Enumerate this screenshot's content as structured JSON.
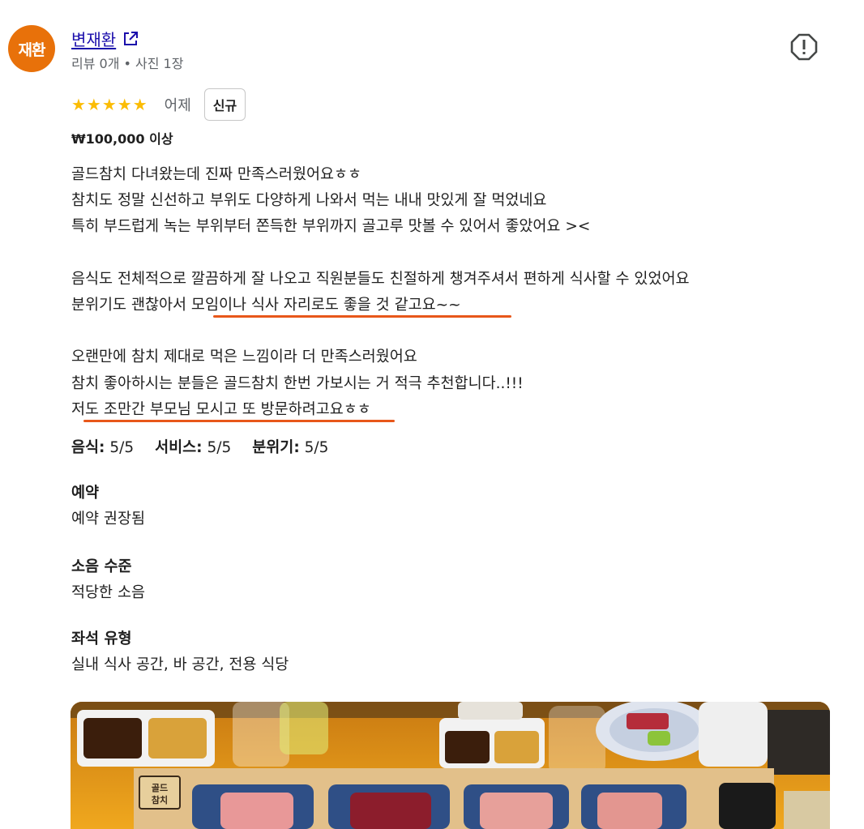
{
  "author": {
    "avatar_text": "재환",
    "name": "변재환",
    "meta": "리뷰 0개 • 사진 1장"
  },
  "rating": {
    "stars": "★★★★★",
    "time": "어제",
    "badge": "신규"
  },
  "price": "₩100,000 이상",
  "review_lines": [
    "골드참치 다녀왔는데 진짜 만족스러웠어요ㅎㅎ",
    "참치도 정말 신선하고 부위도 다양하게 나와서 먹는 내내 맛있게 잘 먹었네요",
    "특히 부드럽게 녹는 부위부터 쫀득한 부위까지 골고루 맛볼 수 있어서 좋았어요 ><",
    "",
    "음식도 전체적으로 깔끔하게 잘 나오고 직원분들도 친절하게 챙겨주셔서 편하게 식사할 수 있었어요",
    "분위기도 괜찮아서 모임이나 식사 자리로도 좋을 것 같고요~~",
    "",
    "오랜만에 참치 제대로 먹은 느낌이라 더 만족스러웠어요",
    "참치 좋아하시는 분들은 골드참치 한번 가보시는 거 적극 추천합니다..!!!",
    "저도 조만간 부모님 모시고 또 방문하려고요ㅎㅎ"
  ],
  "scores": [
    {
      "label": "음식:",
      "value": "5/5"
    },
    {
      "label": "서비스:",
      "value": "5/5"
    },
    {
      "label": "분위기:",
      "value": "5/5"
    }
  ],
  "details": {
    "reservation": {
      "title": "예약",
      "value": "예약 권장됨"
    },
    "noise": {
      "title": "소음 수준",
      "value": "적당한 소음"
    },
    "seating": {
      "title": "좌석 유형",
      "value": "실내 식사 공간, 바 공간, 전용 식당"
    }
  },
  "photo": {
    "tray_logo_text": "골드\n참치"
  },
  "colors": {
    "accent_orange": "#e8710a",
    "star": "#fbbc04",
    "link": "#1a0dab",
    "annotation_underline": "#e8571a"
  }
}
